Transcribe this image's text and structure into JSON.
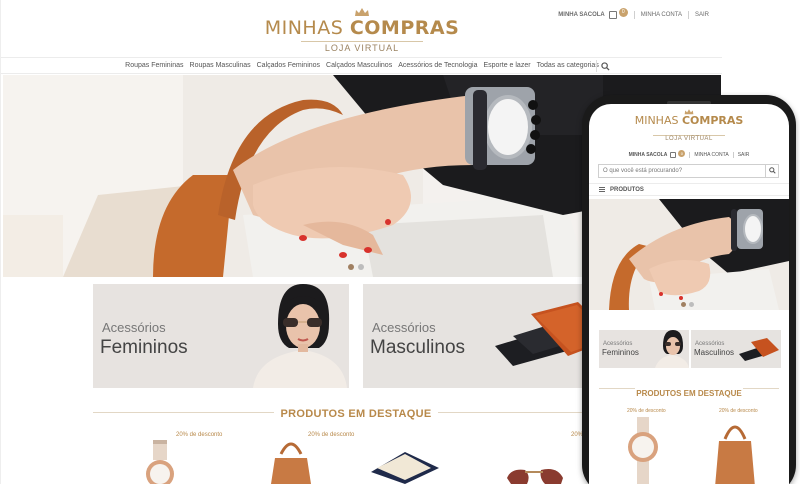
{
  "brand": {
    "name_light": "MINHAS ",
    "name_bold": "COMPRAS",
    "tagline": "LOJA VIRTUAL",
    "gold": "#b58a4c"
  },
  "account": {
    "bag_label": "MINHA SACOLA",
    "bag_count": "0",
    "my_account": "MINHA CONTA",
    "logout": "SAIR"
  },
  "nav": {
    "items": [
      "Roupas Femininas",
      "Roupas Masculinas",
      "Calçados Femininos",
      "Calçados Masculinos",
      "Acessórios de Tecnologia",
      "Esporte e lazer",
      "Todas as categorias"
    ]
  },
  "categories": [
    {
      "small": "Acessórios",
      "big": "Femininos"
    },
    {
      "small": "Acessórios",
      "big": "Masculinos"
    }
  ],
  "featured": {
    "title": "PRODUTOS EM DESTAQUE",
    "discount": "20% de desconto"
  },
  "mobile": {
    "search_placeholder": "O que você está procurando?",
    "menu_label": "PRODUTOS"
  }
}
